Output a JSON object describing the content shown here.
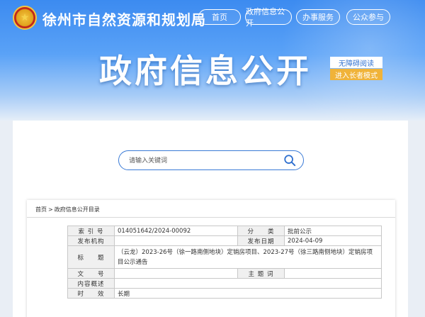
{
  "site": {
    "name": "徐州市自然资源和规划局",
    "nav": [
      "首页",
      "政府信息公开",
      "办事服务",
      "公众参与"
    ],
    "banner_title": "政府信息公开",
    "accessibility": {
      "barrier_free": "无障碍阅读",
      "elderly_mode": "进入长者模式"
    }
  },
  "search": {
    "placeholder": "请输入关键词"
  },
  "breadcrumb": {
    "home": "首页",
    "sep": ">",
    "current": "政府信息公开目录"
  },
  "meta": {
    "index_label": "索 引 号",
    "index_value": "014051642/2024-00092",
    "category_label": "分　　类",
    "category_value": "批前公示",
    "publisher_label": "发布机构",
    "publisher_value": "",
    "date_label": "发布日期",
    "date_value": "2024-04-09",
    "title_label": "标　　题",
    "title_value": "（云龙）2023-26号（徐一路南侧地块）定销房项目、2023-27号（徐三路南侧地块）定销房项目公示通告",
    "doc_no_label": "文　　号",
    "doc_no_value": "",
    "subject_label": "主 题 词",
    "subject_value": "",
    "summary_label": "内容概述",
    "summary_value": "",
    "period_label": "时　　效",
    "period_value": "长期"
  },
  "colors": {
    "header_blue": "#3c8bf0",
    "accent_orange": "#f0b339",
    "search_border": "#3a7ad6"
  }
}
